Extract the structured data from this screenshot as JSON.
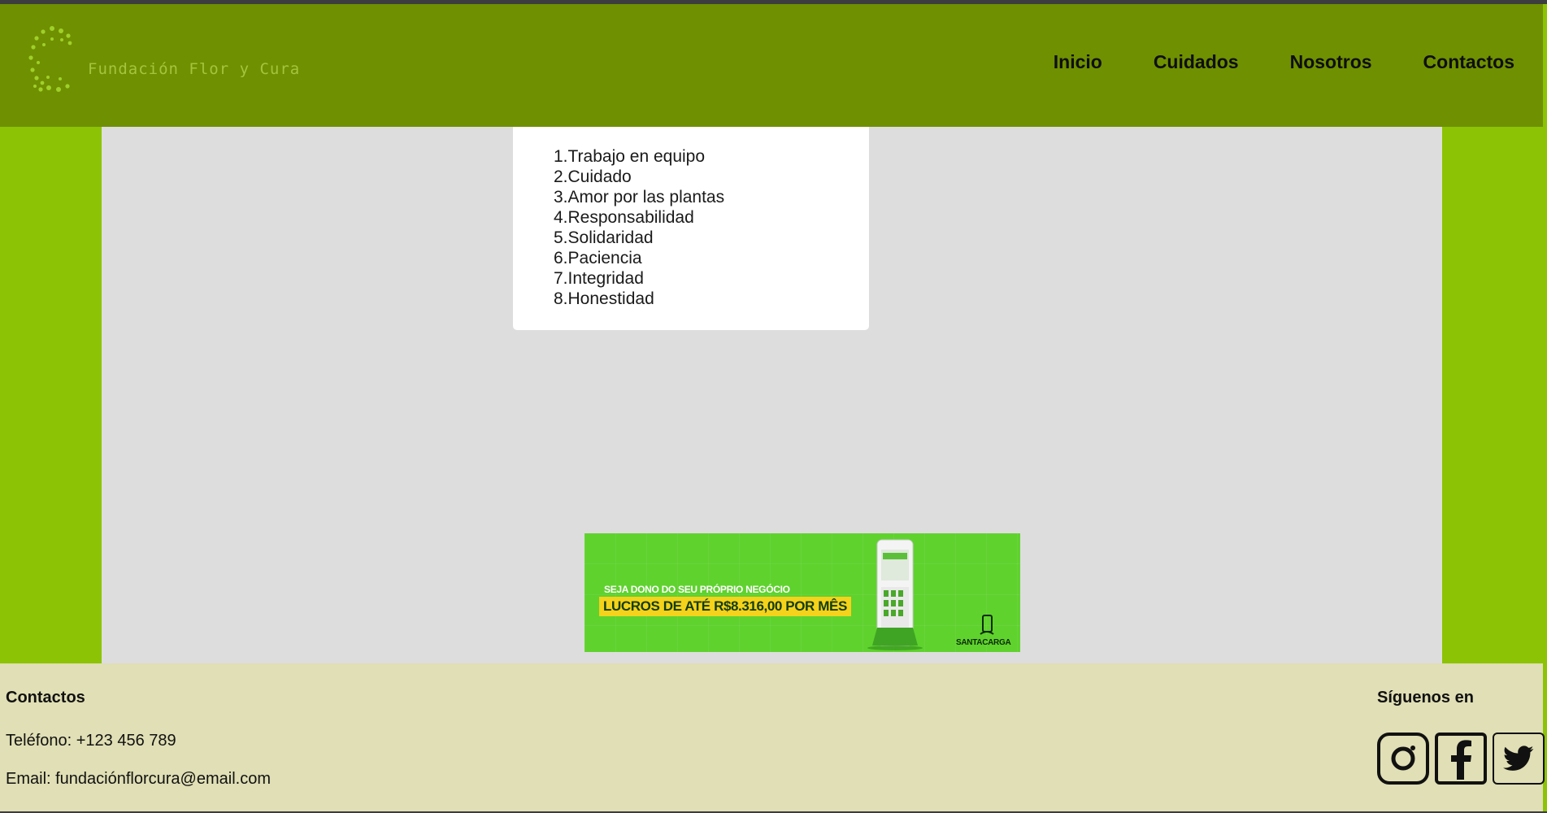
{
  "header": {
    "logo_text": "Fundación Flor y Cura",
    "nav": [
      "Inicio",
      "Cuidados",
      "Nosotros",
      "Contactos"
    ]
  },
  "values_list": [
    "1.Trabajo en equipo",
    "2.Cuidado",
    "3.Amor por las plantas",
    "4.Responsabilidad",
    "5.Solidaridad",
    "6.Paciencia",
    "7.Integridad",
    "8.Honestidad"
  ],
  "ad": {
    "headline_small": "SEJA DONO DO SEU PRÓPRIO NEGÓCIO",
    "headline_big": "LUCROS DE ATÉ R$8.316,00 POR MÊS",
    "brand": "SANTACARGA"
  },
  "footer": {
    "contacts_title": "Contactos",
    "phone": "Teléfono: +123 456 789",
    "email": "Email: fundaciónflorcura@email.com",
    "social_title": "Síguenos en",
    "social_icons": [
      "instagram-icon",
      "facebook-icon",
      "twitter-icon"
    ]
  },
  "colors": {
    "header_bg": "#6f9000",
    "side_green": "#8cc304",
    "main_bg": "#dddddd",
    "footer_bg": "#e0dfb5",
    "ad_green": "#5fd22e",
    "ad_yellow": "#f5d21b"
  }
}
